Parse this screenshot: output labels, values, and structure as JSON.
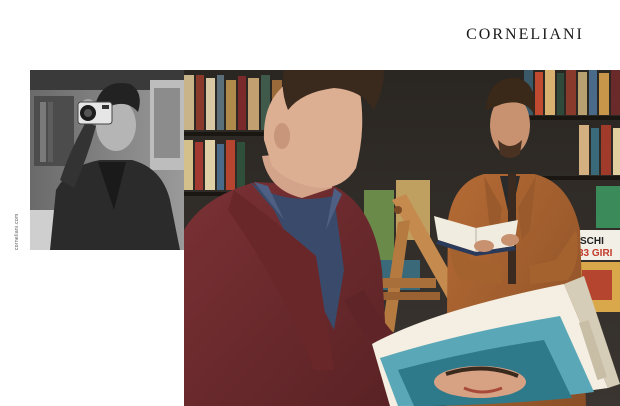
{
  "brand": {
    "name": "CORNELIANI"
  },
  "side_text": {
    "url": "corneliani.com"
  },
  "signs": {
    "sign_1": "SCHI",
    "sign_2": "33 GIRI"
  },
  "colors": {
    "background": "#ffffff",
    "brand_text": "#1a1a1a",
    "jumper": "#6e2a2c",
    "jacket": "#a05f30"
  }
}
